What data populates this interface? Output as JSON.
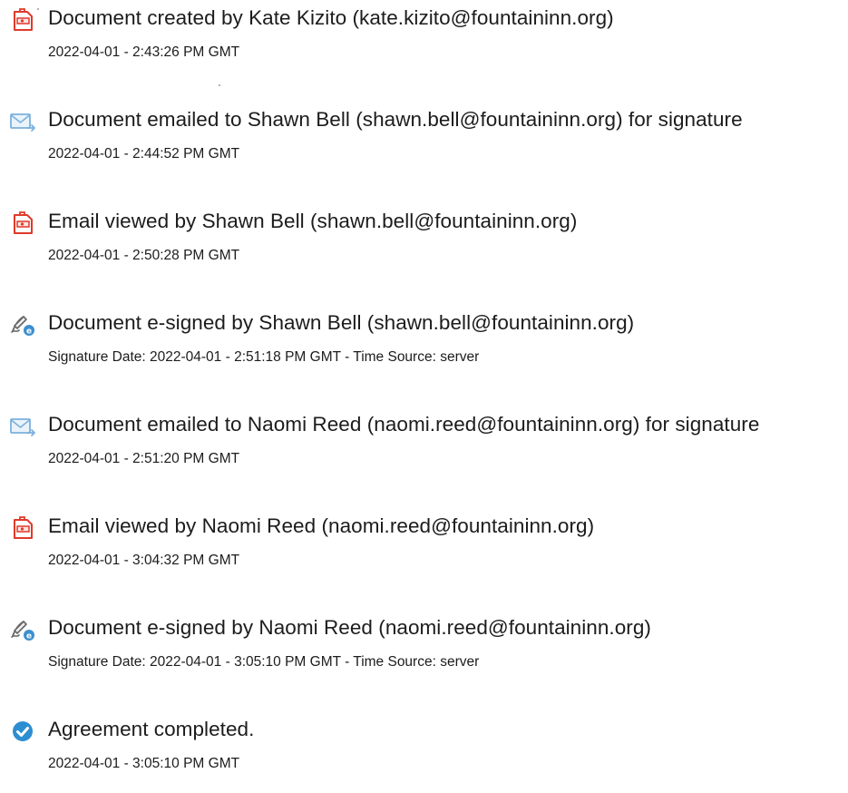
{
  "events": [
    {
      "icon": "document-created-icon",
      "text": "Document created by Kate Kizito (kate.kizito@fountaininn.org)",
      "time": "2022-04-01 - 2:43:26 PM GMT"
    },
    {
      "icon": "email-sent-icon",
      "text": "Document emailed to Shawn Bell (shawn.bell@fountaininn.org) for signature",
      "time": "2022-04-01 - 2:44:52 PM GMT"
    },
    {
      "icon": "email-viewed-icon",
      "text": "Email viewed by Shawn Bell (shawn.bell@fountaininn.org)",
      "time": "2022-04-01 - 2:50:28 PM GMT"
    },
    {
      "icon": "e-signed-icon",
      "text": "Document e-signed by Shawn Bell (shawn.bell@fountaininn.org)",
      "time": "Signature Date: 2022-04-01 - 2:51:18 PM GMT - Time Source: server"
    },
    {
      "icon": "email-sent-icon",
      "text": "Document emailed to Naomi Reed (naomi.reed@fountaininn.org) for signature",
      "time": "2022-04-01 - 2:51:20 PM GMT"
    },
    {
      "icon": "email-viewed-icon",
      "text": "Email viewed by Naomi Reed (naomi.reed@fountaininn.org)",
      "time": "2022-04-01 - 3:04:32 PM GMT"
    },
    {
      "icon": "e-signed-icon",
      "text": "Document e-signed by Naomi Reed (naomi.reed@fountaininn.org)",
      "time": "Signature Date: 2022-04-01 - 3:05:10 PM GMT - Time Source: server"
    },
    {
      "icon": "agreement-completed-icon",
      "text": "Agreement completed.",
      "time": "2022-04-01 - 3:05:10 PM GMT"
    }
  ],
  "colors": {
    "document_icon_red": "#e0392b",
    "email_icon_blue": "#7bb0dc",
    "completed_icon_blue": "#2d8ed1",
    "text": "#1c1c1c"
  }
}
